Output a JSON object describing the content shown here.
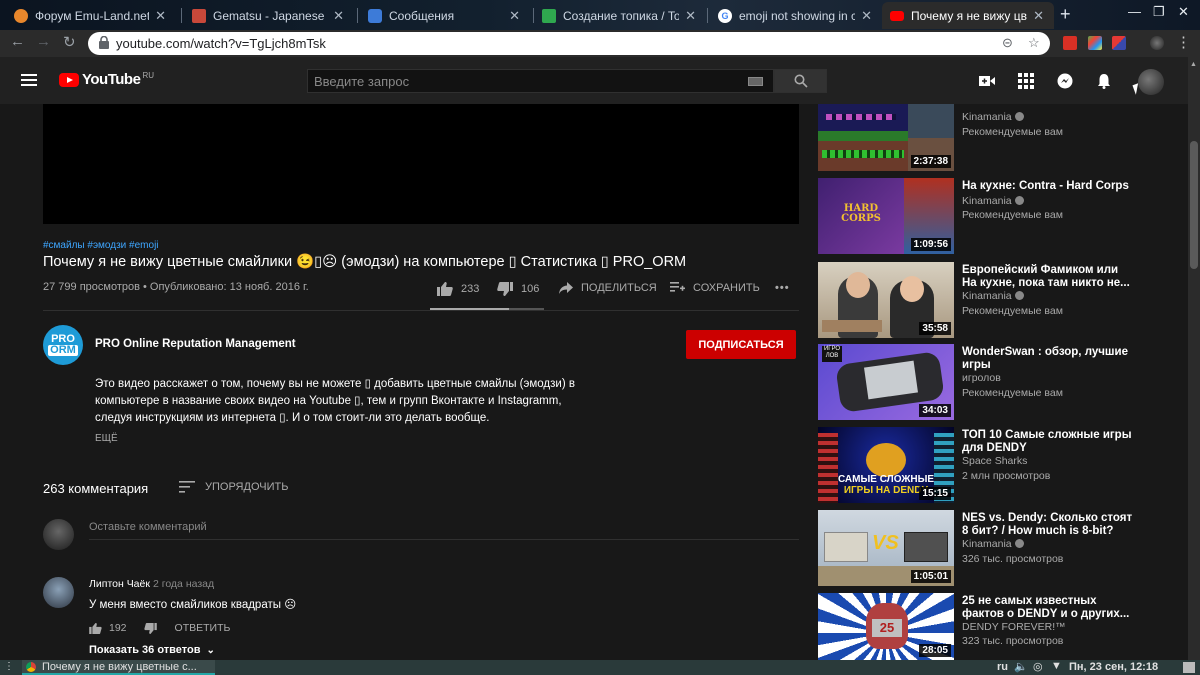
{
  "browser": {
    "tabs": [
      {
        "title": "Форум Emu-Land.net",
        "favicon": "emu-land-icon",
        "active": false
      },
      {
        "title": "Gematsu - Japanese Vi",
        "favicon": "gematsu-icon",
        "active": false
      },
      {
        "title": "Сообщения",
        "favicon": "messages-icon",
        "active": false
      },
      {
        "title": "Создание топика / To",
        "favicon": "forum-icon",
        "active": false
      },
      {
        "title": "emoji not showing in c",
        "favicon": "google-icon",
        "active": false
      },
      {
        "title": "Почему я не вижу цве",
        "favicon": "youtube-icon",
        "active": true
      }
    ],
    "url": "youtube.com/watch?v=TgLjch8mTsk"
  },
  "youtube": {
    "logo_text": "YouTube",
    "logo_region": "RU",
    "search_placeholder": "Введите запрос"
  },
  "video": {
    "hashtags": "#смайлы #эмодзи #emoji",
    "title": "Почему я не вижу цветные смайлики 😉▯☹ (эмодзи) на компьютере ▯ Статистика ▯ PRO_ORM",
    "meta": "27 799 просмотров • Опубликовано: 13 нояб. 2016 г.",
    "likes": "233",
    "dislikes": "106",
    "like_ratio": 0.69,
    "share_label": "ПОДЕЛИТЬСЯ",
    "save_label": "СОХРАНИТЬ",
    "more_label": "•••"
  },
  "channel": {
    "avatar_top": "PRO",
    "avatar_bottom": "ORM",
    "name": "PRO Online Reputation Management",
    "subscribe_label": "ПОДПИСАТЬСЯ",
    "description": [
      "Это видео расскажет о том, почему вы не можете ▯ добавить цветные смайлы (эмодзи) в",
      "компьютере в название своих видео на Youtube ▯, тем и групп Вконтакте и Instagramm,",
      "следуя инструкциям из интернета ▯. И о том стоит-ли это делать вообще."
    ],
    "more_label": "ЕЩЁ"
  },
  "comments": {
    "count_label": "263 комментария",
    "sort_label": "УПОРЯДОЧИТЬ",
    "input_placeholder": "Оставьте комментарий",
    "items": [
      {
        "author": "Липтон Чаёк",
        "date": "2 года назад",
        "text": "У меня вместо смайликов квадраты ☹",
        "likes": "192",
        "reply_label": "ОТВЕТИТЬ",
        "replies_label": "Показать 36 ответов"
      }
    ]
  },
  "recommendations": [
    {
      "title": "",
      "channel": "Kinamania",
      "verified": true,
      "views": "Рекомендуемые вам",
      "duration": "2:37:38",
      "thumb": "thumb-retro-game"
    },
    {
      "title": "На кухне: Contra - Hard Corps",
      "channel": "Kinamania",
      "verified": true,
      "views": "Рекомендуемые вам",
      "duration": "1:09:56",
      "thumb": "thumb-contra"
    },
    {
      "title": "Европейский Фамиком или На кухне, пока там никто не...",
      "channel": "Kinamania",
      "verified": true,
      "views": "Рекомендуемые вам",
      "duration": "35:58",
      "thumb": "thumb-kitchen"
    },
    {
      "title": "WonderSwan : обзор, лучшие игры",
      "channel": "игролов",
      "verified": false,
      "views": "Рекомендуемые вам",
      "duration": "34:03",
      "thumb": "thumb-wonderswan"
    },
    {
      "title": "ТОП 10 Самые сложные игры для DENDY",
      "channel": "Space Sharks",
      "verified": false,
      "views": "2 млн просмотров",
      "duration": "15:15",
      "thumb": "thumb-dendy-hard"
    },
    {
      "title": "NES vs. Dendy: Сколько стоят 8 бит? / How much is 8-bit?",
      "channel": "Kinamania",
      "verified": true,
      "views": "326 тыс. просмотров",
      "duration": "1:05:01",
      "thumb": "thumb-nes-vs"
    },
    {
      "title": "25 не самых известных фактов о DENDY и о других...",
      "channel": "DENDY FOREVER!™",
      "verified": false,
      "views": "323 тыс. просмотров",
      "duration": "28:05",
      "thumb": "thumb-25-facts"
    }
  ],
  "thumb_text": {
    "contra_logo": "HARD CORPS",
    "dendy_hard_line1": "САМЫЕ СЛОЖНЫЕ",
    "dendy_hard_line2": "ИГРЫ НА DENDY",
    "nes_vs": "VS",
    "facts_number": "25",
    "wonderswan_badge": "ИГРО\nЛОВ"
  },
  "taskbar": {
    "window_title": "Почему я не вижу цветные с...",
    "language": "ru",
    "clock": "Пн, 23 сен, 12:18"
  },
  "colors": {
    "yt_red": "#ff0000",
    "subscribe_red": "#cc0000",
    "link_blue": "#3ea6ff",
    "bg_dark": "#181818"
  }
}
